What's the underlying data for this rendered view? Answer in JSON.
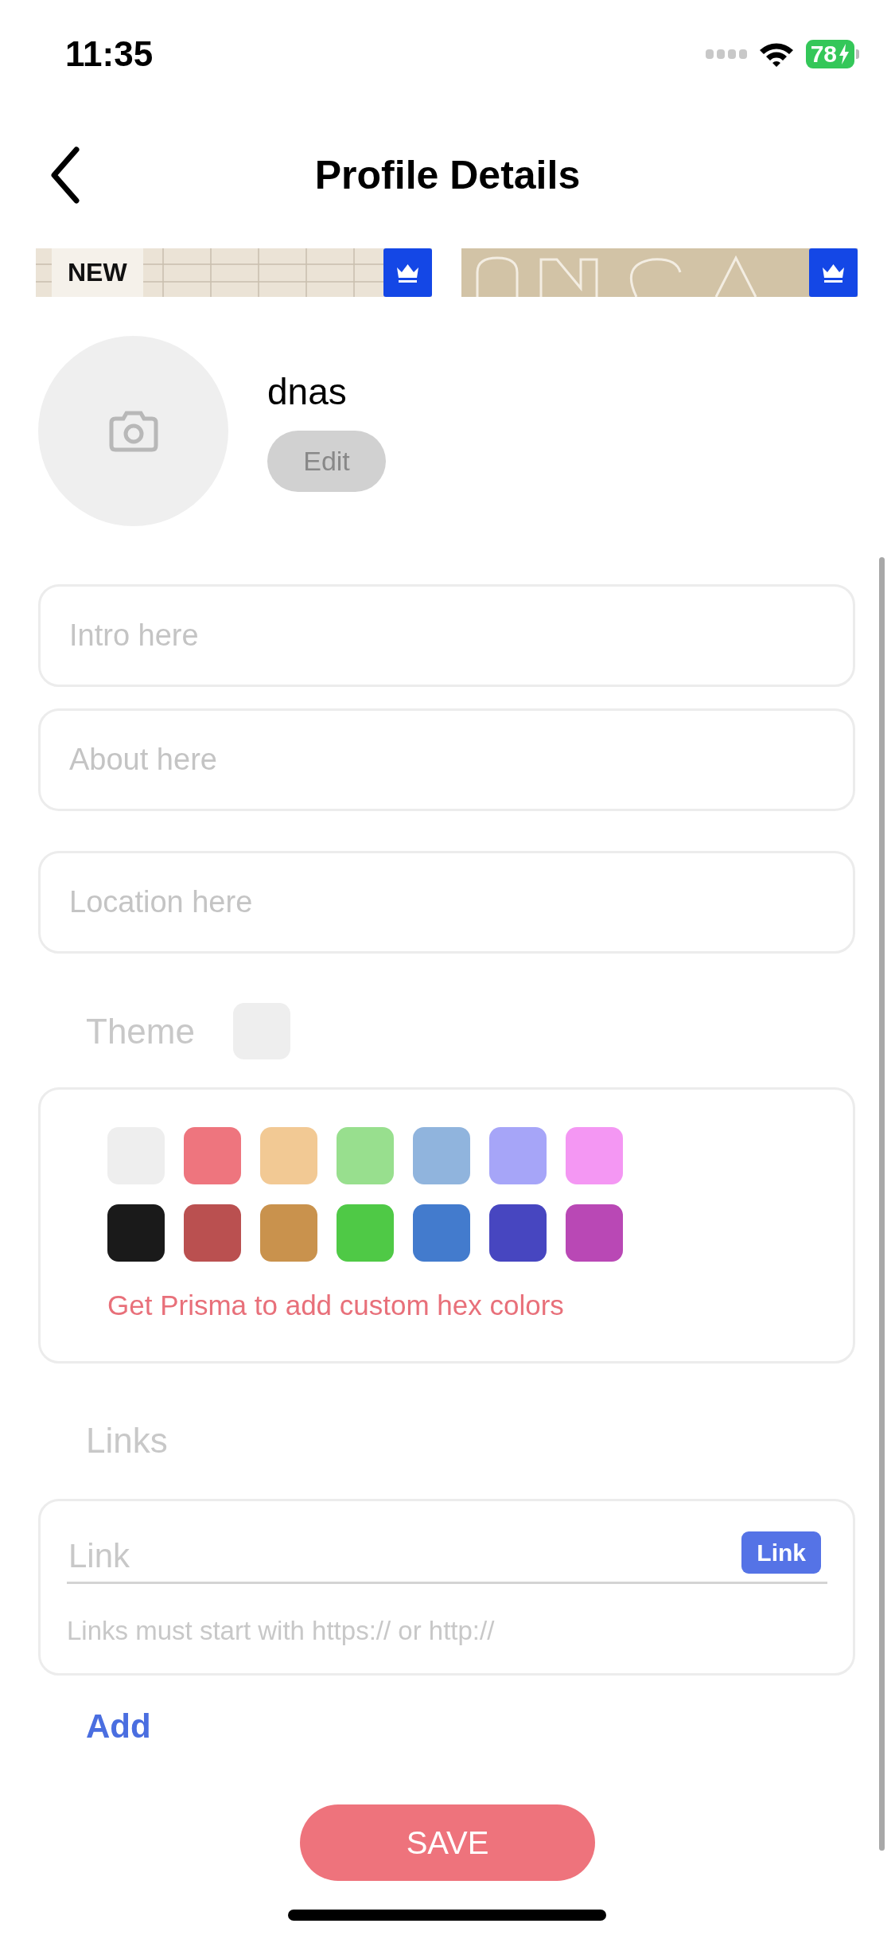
{
  "status_bar": {
    "time": "11:35",
    "battery": "78",
    "charging": true
  },
  "nav": {
    "title": "Profile Details"
  },
  "banners": [
    {
      "kind": "picture",
      "tag": "NEW",
      "premium": true
    },
    {
      "kind": "picture",
      "premium": true
    }
  ],
  "profile": {
    "username": "dnas",
    "edit_button": "Edit"
  },
  "fields": [
    {
      "placeholder": "Intro here"
    },
    {
      "placeholder": "About here"
    },
    {
      "placeholder": "Location here"
    }
  ],
  "theme": {
    "label": "Theme",
    "color": "#eeeeee",
    "swatches": [
      {
        "color": "#eeeeee"
      },
      {
        "color": "#ee757e"
      },
      {
        "color": "#f2c994"
      },
      {
        "color": "#98df8e"
      },
      {
        "color": "#90b4dd"
      },
      {
        "color": "#a6a5f8"
      },
      {
        "color": "#f497f3"
      },
      {
        "color": "#1a1a1a"
      },
      {
        "color": "#ba5050"
      },
      {
        "color": "#c9924d"
      },
      {
        "color": "#4fc946"
      },
      {
        "color": "#437bcd"
      },
      {
        "color": "#4746c0"
      },
      {
        "color": "#b948b5"
      }
    ],
    "note": "Get Prisma to add custom hex colors"
  },
  "links": {
    "label": "Links",
    "placeholder": "Link",
    "link_button": "Link",
    "hint": "Links must start with https:// or http://",
    "add_button": "Add"
  },
  "save_button": "SAVE"
}
